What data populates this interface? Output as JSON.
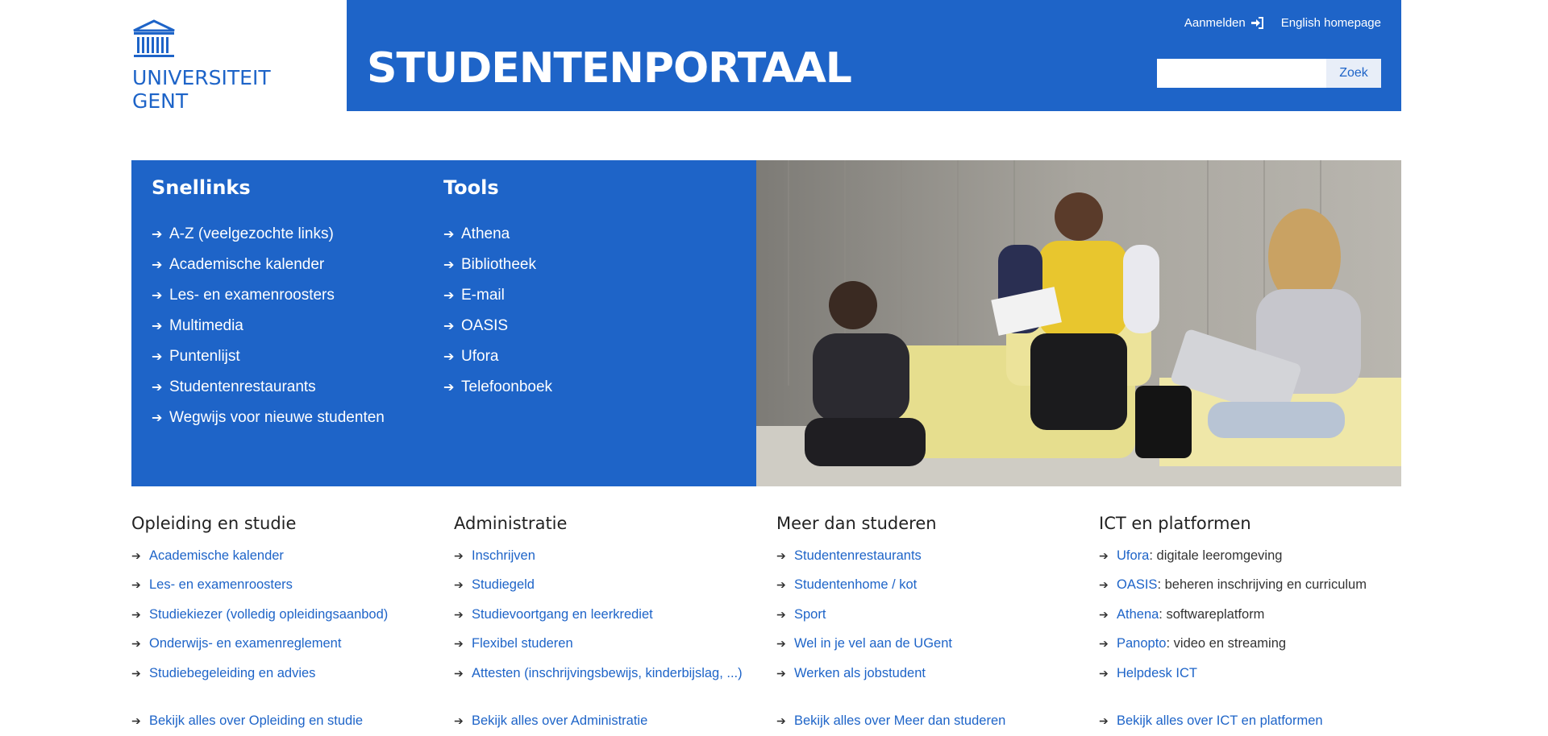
{
  "logo": {
    "line1": "UNIVERSITEIT",
    "line2": "GENT"
  },
  "header": {
    "title": "STUDENTENPORTAAL",
    "login_label": "Aanmelden",
    "english_label": "English homepage",
    "search_placeholder": "",
    "search_button": "Zoek"
  },
  "snellinks": {
    "title": "Snellinks",
    "items": [
      "A-Z (veelgezochte links)",
      "Academische kalender",
      "Les- en examenroosters",
      "Multimedia",
      "Puntenlijst",
      "Studentenrestaurants",
      "Wegwijs voor nieuwe studenten"
    ]
  },
  "tools": {
    "title": "Tools",
    "items": [
      "Athena",
      "Bibliotheek",
      "E-mail",
      "OASIS",
      "Ufora",
      "Telefoonboek"
    ]
  },
  "categories": [
    {
      "title": "Opleiding en studie",
      "items": [
        {
          "link": "Academische kalender",
          "rest": ""
        },
        {
          "link": "Les- en examenroosters",
          "rest": ""
        },
        {
          "link": "Studiekiezer (volledig opleidingsaanbod)",
          "rest": ""
        },
        {
          "link": "Onderwijs- en examenreglement",
          "rest": ""
        },
        {
          "link": "Studiebegeleiding en advies",
          "rest": ""
        }
      ],
      "more": "Bekijk alles over Opleiding en studie"
    },
    {
      "title": "Administratie",
      "items": [
        {
          "link": "Inschrijven",
          "rest": ""
        },
        {
          "link": "Studiegeld",
          "rest": ""
        },
        {
          "link": "Studievoortgang en leerkrediet",
          "rest": ""
        },
        {
          "link": "Flexibel studeren",
          "rest": ""
        },
        {
          "link": "Attesten (inschrijvingsbewijs, kinderbijslag, ...)",
          "rest": ""
        }
      ],
      "more": "Bekijk alles over Administratie"
    },
    {
      "title": "Meer dan studeren",
      "items": [
        {
          "link": "Studentenrestaurants",
          "rest": ""
        },
        {
          "link": "Studentenhome / kot",
          "rest": ""
        },
        {
          "link": "Sport",
          "rest": ""
        },
        {
          "link": "Wel in je vel aan de UGent",
          "rest": ""
        },
        {
          "link": "Werken als jobstudent",
          "rest": ""
        }
      ],
      "more": "Bekijk alles over Meer dan studeren"
    },
    {
      "title": "ICT en platformen",
      "items": [
        {
          "link": "Ufora",
          "rest": ": digitale leeromgeving"
        },
        {
          "link": "OASIS",
          "rest": ": beheren inschrijving en curriculum"
        },
        {
          "link": "Athena",
          "rest": ": softwareplatform"
        },
        {
          "link": "Panopto",
          "rest": ": video en streaming"
        },
        {
          "link": "Helpdesk ICT",
          "rest": ""
        }
      ],
      "more": "Bekijk alles over ICT en platformen"
    }
  ],
  "colors": {
    "brand_blue": "#1e64c8"
  },
  "icons": {
    "login": "sign-in-icon",
    "arrow": "arrow-right-icon",
    "logo": "ugent-building-icon"
  }
}
